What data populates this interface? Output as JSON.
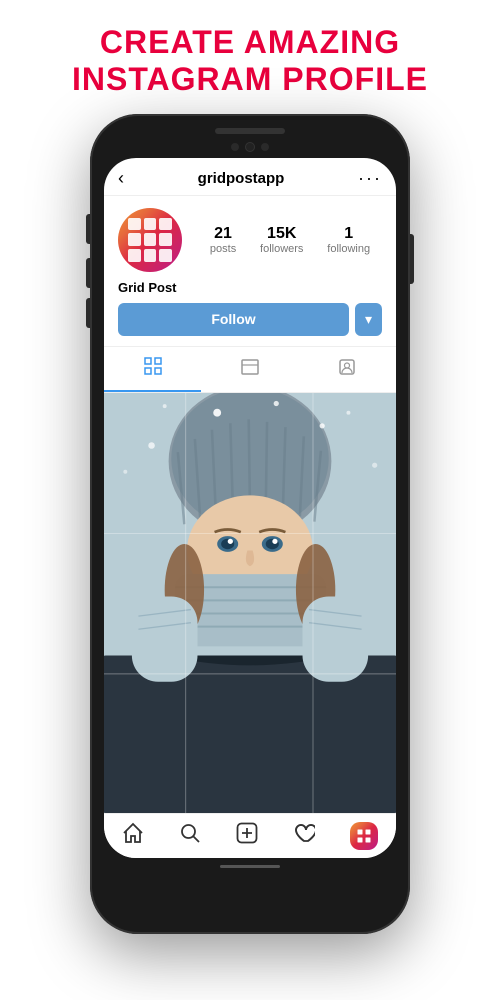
{
  "headline": {
    "line1": "CREATE AMAZING",
    "line2": "INSTAGRAM PROFILE"
  },
  "phone": {
    "screen": {
      "header": {
        "back_label": "‹",
        "username": "gridpostapp",
        "more_label": "···"
      },
      "profile": {
        "avatar_alt": "Grid Post App Logo",
        "stats": [
          {
            "number": "21",
            "label": "posts"
          },
          {
            "number": "15K",
            "label": "followers"
          },
          {
            "number": "1",
            "label": "following"
          }
        ],
        "name": "Grid Post",
        "follow_button": "Follow",
        "dropdown_icon": "▾"
      },
      "tabs": [
        {
          "icon": "⊞",
          "label": "grid",
          "active": true
        },
        {
          "icon": "▭",
          "label": "reels",
          "active": false
        },
        {
          "icon": "👤",
          "label": "tagged",
          "active": false
        }
      ],
      "bottom_nav": [
        {
          "icon": "⌂",
          "label": "home"
        },
        {
          "icon": "⌕",
          "label": "search"
        },
        {
          "icon": "⊕",
          "label": "add"
        },
        {
          "icon": "♡",
          "label": "likes"
        },
        {
          "icon": "⊞",
          "label": "profile",
          "active": true
        }
      ]
    }
  }
}
